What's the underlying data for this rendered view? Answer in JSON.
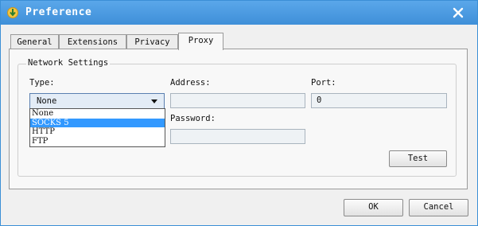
{
  "window": {
    "title": "Preference"
  },
  "tabs": [
    {
      "label": "General"
    },
    {
      "label": "Extensions"
    },
    {
      "label": "Privacy"
    },
    {
      "label": "Proxy"
    }
  ],
  "active_tab": "Proxy",
  "network": {
    "group_label": "Network Settings",
    "type_label": "Type:",
    "type_value": "None",
    "type_options": [
      "None",
      "SOCKS 5",
      "HTTP",
      "FTP"
    ],
    "highlighted_option": "SOCKS 5",
    "address_label": "Address:",
    "address_value": "",
    "port_label": "Port:",
    "port_value": "0",
    "password_label": "Password:",
    "password_value": "",
    "test_button": "Test"
  },
  "footer": {
    "ok_button": "OK",
    "cancel_button": "Cancel"
  },
  "colors": {
    "titlebar": "#4a9be2",
    "highlight": "#3399ff"
  }
}
